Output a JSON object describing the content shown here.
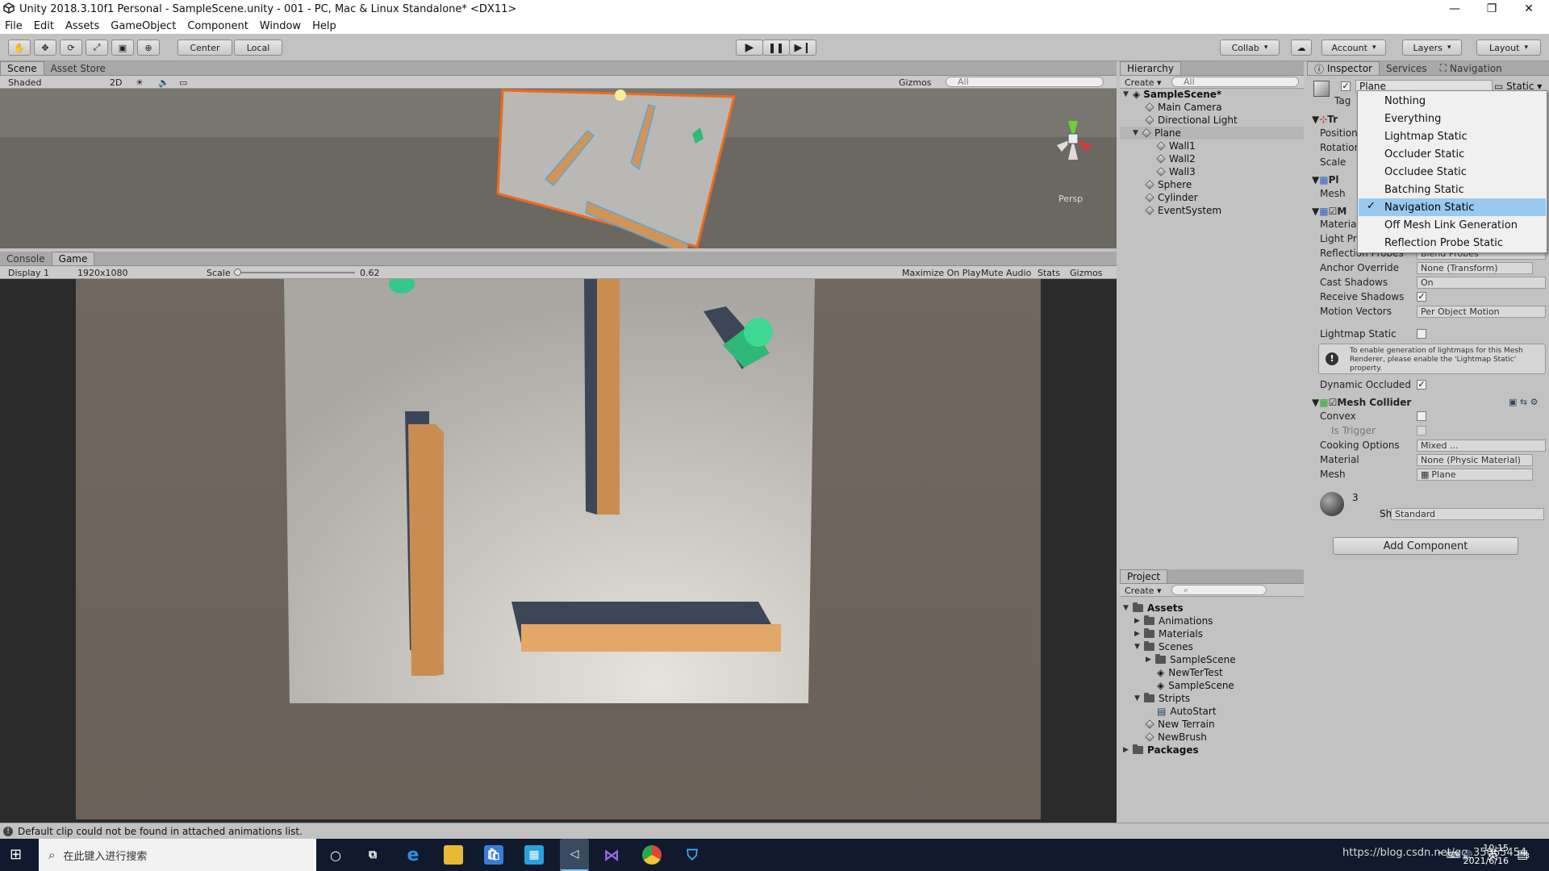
{
  "window": {
    "title": "Unity 2018.3.10f1 Personal - SampleScene.unity - 001 - PC, Mac & Linux Standalone* <DX11>"
  },
  "menu": [
    "File",
    "Edit",
    "Assets",
    "GameObject",
    "Component",
    "Window",
    "Help"
  ],
  "toolbar": {
    "center": "Center",
    "local": "Local",
    "collab": "Collab",
    "account": "Account",
    "layers": "Layers",
    "layout": "Layout"
  },
  "scene": {
    "tabs": [
      "Scene",
      "Asset Store"
    ],
    "shading": "Shaded",
    "mode2d": "2D",
    "gizmos": "Gizmos",
    "search_placeholder": "All",
    "persp": "Persp"
  },
  "game": {
    "tabs": [
      "Console",
      "Game"
    ],
    "display": "Display 1",
    "resolution": "1920x1080",
    "scale_label": "Scale",
    "scale_value": "0.62",
    "maximize": "Maximize On Play",
    "mute": "Mute Audio",
    "stats": "Stats",
    "gizmos": "Gizmos"
  },
  "hierarchy": {
    "tab": "Hierarchy",
    "create": "Create",
    "search_placeholder": "All",
    "scene_name": "SampleScene*",
    "items": [
      "Main Camera",
      "Directional Light",
      "Plane",
      "Wall1",
      "Wall2",
      "Wall3",
      "Sphere",
      "Cylinder",
      "EventSystem"
    ]
  },
  "project": {
    "tab": "Project",
    "create": "Create",
    "assets_label": "Assets",
    "items": [
      "Animations",
      "Materials",
      "Scenes",
      "SampleScene",
      "NewTerTest",
      "SampleScene",
      "Stripts",
      "AutoStart",
      "New Terrain",
      "NewBrush"
    ],
    "packages_label": "Packages"
  },
  "inspector": {
    "tabs": [
      "Inspector",
      "Services",
      "Navigation"
    ],
    "object_name": "Plane",
    "static_label": "Static",
    "tag_label": "Tag",
    "transform_short": "Tr",
    "transform_labels": [
      "Position",
      "Rotation",
      "Scale"
    ],
    "meshfilter_short": "Pl",
    "mesh_label": "Mesh",
    "renderer_short": "M",
    "renderer_labels": [
      "Material",
      "Light Pro",
      "Reflection Probes"
    ],
    "reflection_value": "Blend Probes",
    "anchor_override": {
      "label": "Anchor Override",
      "value": "None (Transform)"
    },
    "cast_shadows": {
      "label": "Cast Shadows",
      "value": "On"
    },
    "receive_shadows": {
      "label": "Receive Shadows"
    },
    "motion_vectors": {
      "label": "Motion Vectors",
      "value": "Per Object Motion"
    },
    "lightmap_static": {
      "label": "Lightmap Static"
    },
    "help_text": "To enable generation of lightmaps for this Mesh Renderer, please enable the 'Lightmap Static' property.",
    "dynamic_occluded": {
      "label": "Dynamic Occluded"
    },
    "mesh_collider": {
      "title": "Mesh Collider",
      "convex": "Convex",
      "is_trigger": "Is Trigger",
      "cooking_label": "Cooking Options",
      "cooking_value": "Mixed ...",
      "material_label": "Material",
      "material_value": "None (Physic Material)",
      "mesh_label": "Mesh",
      "mesh_value": "Plane"
    },
    "material_name": "3",
    "shader_label": "Shader",
    "shader_value": "Standard",
    "add_component": "Add Component"
  },
  "static_menu": {
    "items": [
      "Nothing",
      "Everything",
      "Lightmap Static",
      "Occluder Static",
      "Occludee Static",
      "Batching Static",
      "Navigation Static",
      "Off Mesh Link Generation",
      "Reflection Probe Static"
    ],
    "selected": "Navigation Static"
  },
  "status": {
    "message": "Default clip could not be found in attached animations list."
  },
  "taskbar": {
    "search_placeholder": "在此键入进行搜索",
    "watermark": "https://blog.csdn.net/qq_35065454",
    "time": "10:15",
    "date": "2021/6/16",
    "ime": "英",
    "notification_count": "3"
  },
  "colors": {
    "accent": "#99c9ef",
    "wall": "#d09458",
    "shadow": "#3d4656",
    "green": "#2fb877",
    "plane": "#d8d4cc",
    "taskbar": "#101a2c"
  }
}
